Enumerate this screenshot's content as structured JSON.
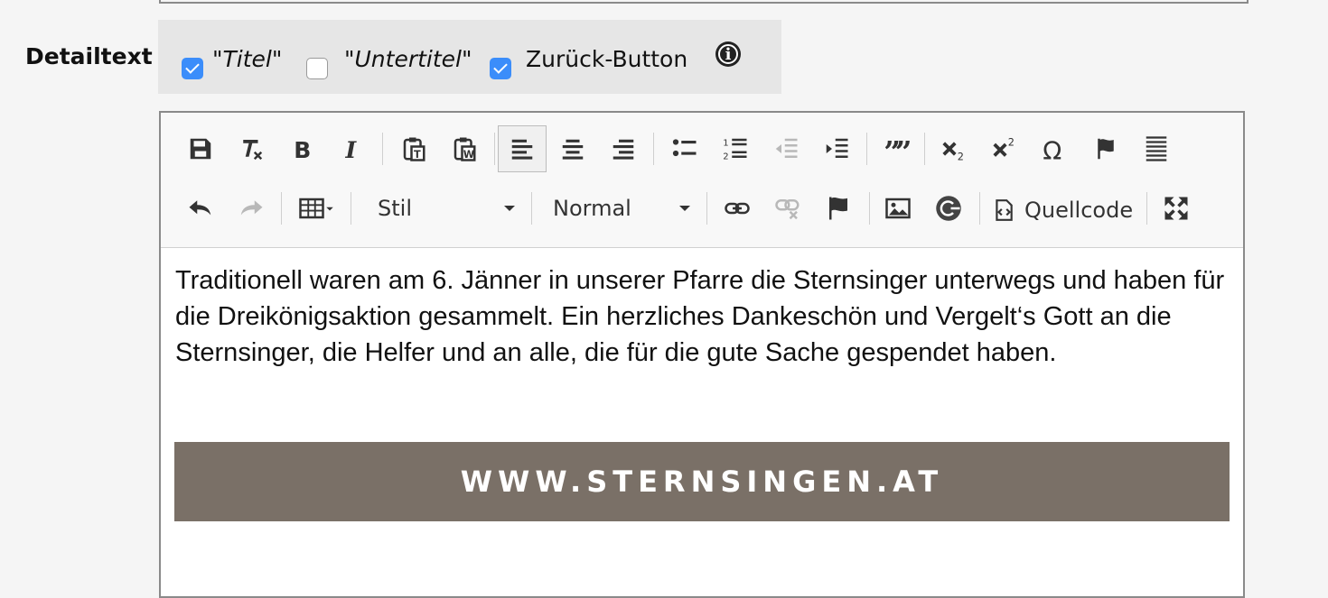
{
  "field": {
    "label": "Detailtext"
  },
  "options": [
    {
      "label": "\"Titel\"",
      "checked": true,
      "italic": true
    },
    {
      "label": "\"Untertitel\"",
      "checked": false,
      "italic": true
    },
    {
      "label": "Zurück-Button",
      "checked": true,
      "italic": false
    }
  ],
  "toolbar": {
    "style_combo": "Stil",
    "format_combo": "Normal",
    "source_label": "Quellcode"
  },
  "content": {
    "paragraph": "Traditionell waren am 6. Jänner in unserer Pfarre die Sternsinger unterwegs und haben für die Dreikönigsaktion gesammelt. Ein herzliches Dankeschön und Vergelt‘s Gott an die Sternsinger, die Helfer und an alle, die für die gute Sache gespendet haben.",
    "banner_text": "WWW.STERNSINGEN.AT"
  },
  "colors": {
    "checkbox_checked": "#3b8dfa",
    "banner_bg": "#7a7067"
  }
}
